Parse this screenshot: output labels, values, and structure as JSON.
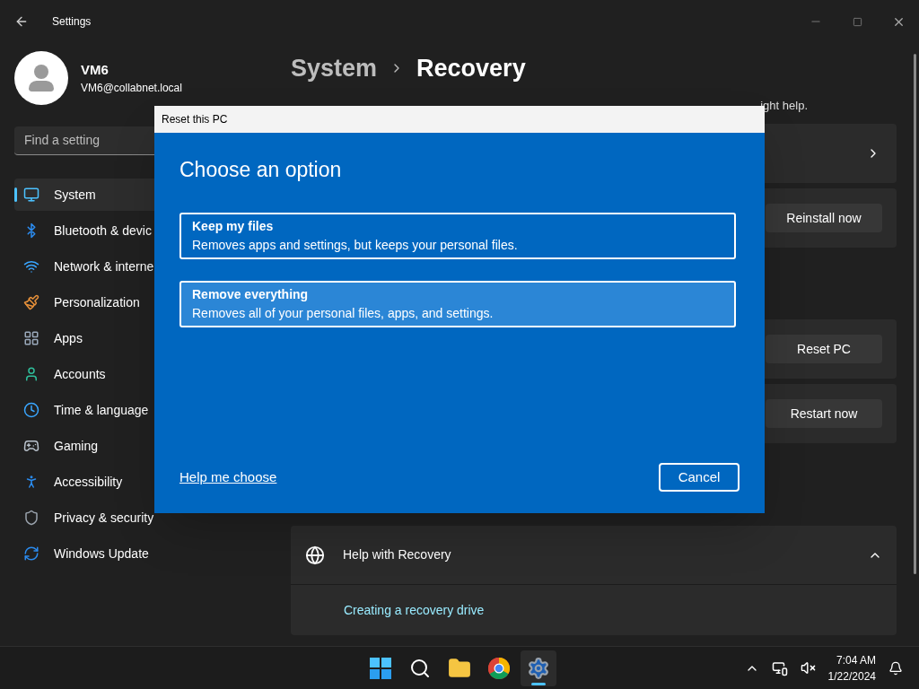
{
  "window": {
    "title": "Settings"
  },
  "user": {
    "name": "VM6",
    "email": "VM6@collabnet.local"
  },
  "search": {
    "placeholder": "Find a setting"
  },
  "nav": [
    {
      "label": "System",
      "kind": "system",
      "selected": true
    },
    {
      "label": "Bluetooth & devic",
      "kind": "bluetooth",
      "selected": false
    },
    {
      "label": "Network & interne",
      "kind": "network",
      "selected": false
    },
    {
      "label": "Personalization",
      "kind": "personalization",
      "selected": false
    },
    {
      "label": "Apps",
      "kind": "apps",
      "selected": false
    },
    {
      "label": "Accounts",
      "kind": "accounts",
      "selected": false
    },
    {
      "label": "Time & language",
      "kind": "time",
      "selected": false
    },
    {
      "label": "Gaming",
      "kind": "gaming",
      "selected": false
    },
    {
      "label": "Accessibility",
      "kind": "accessibility",
      "selected": false
    },
    {
      "label": "Privacy & security",
      "kind": "privacy",
      "selected": false
    },
    {
      "label": "Windows Update",
      "kind": "update",
      "selected": false
    }
  ],
  "breadcrumb": [
    "System",
    "Recovery"
  ],
  "description_fragment": "ight help.",
  "cards": [
    {
      "kind": "link"
    },
    {
      "kind": "button",
      "button": "Reinstall now"
    },
    {
      "kind": "gap"
    },
    {
      "kind": "button",
      "button": "Reset PC"
    },
    {
      "kind": "button",
      "button": "Restart now"
    }
  ],
  "related_support": {
    "section": {
      "title": "Help with Recovery",
      "expanded": true,
      "links": [
        "Creating a recovery drive"
      ]
    }
  },
  "dialog": {
    "title": "Reset this PC",
    "heading": "Choose an option",
    "options": [
      {
        "title": "Keep my files",
        "description": "Removes apps and settings, but keeps your personal files.",
        "selected": false
      },
      {
        "title": "Remove everything",
        "description": "Removes all of your personal files, apps, and settings.",
        "selected": true
      }
    ],
    "help_link": "Help me choose",
    "cancel": "Cancel"
  },
  "taskbar": {
    "apps": [
      {
        "kind": "start",
        "selected": false
      },
      {
        "kind": "search",
        "selected": false
      },
      {
        "kind": "files",
        "selected": false
      },
      {
        "kind": "browser",
        "selected": false
      },
      {
        "kind": "settings",
        "selected": true
      }
    ],
    "time": "7:04 AM",
    "date": "1/22/2024"
  }
}
